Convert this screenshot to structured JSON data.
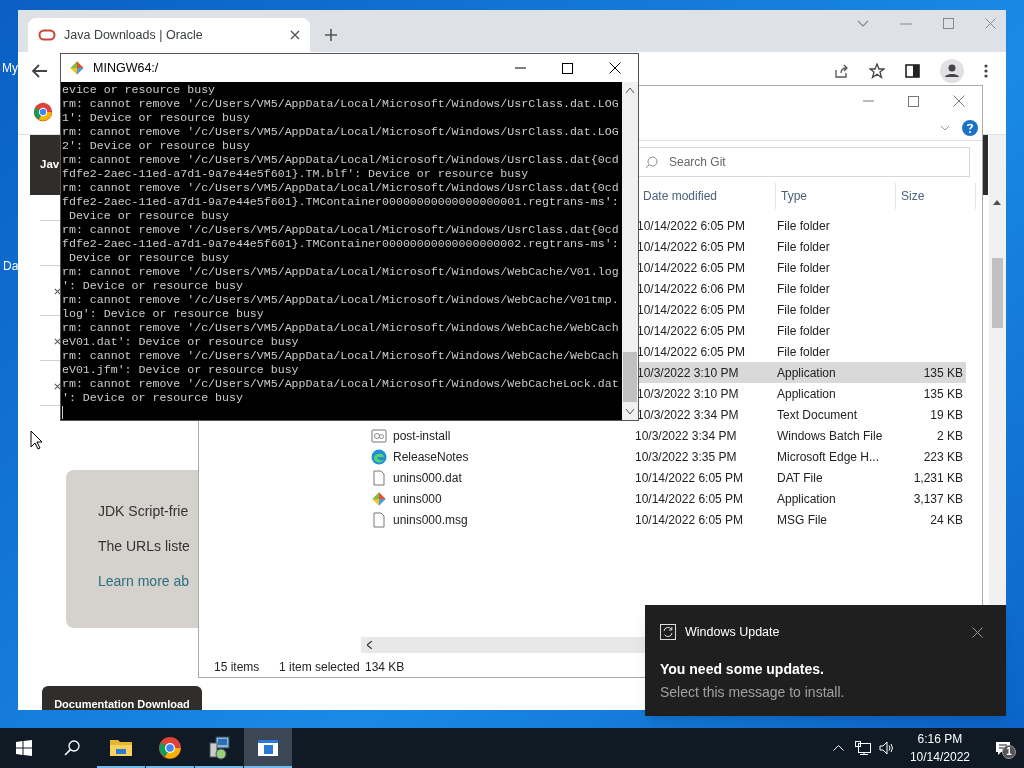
{
  "desktop": {
    "labels": [
      "My",
      "Da"
    ]
  },
  "browser": {
    "tab": {
      "title": "Java Downloads | Oracle",
      "selected": true
    },
    "page": {
      "banner": "Jav",
      "card_lines": [
        "JDK Script-frie",
        "The URLs liste"
      ],
      "card_link": "Learn more ab",
      "doc_button": "Documentation Download"
    }
  },
  "explorer": {
    "search": {
      "placeholder": "Search Git"
    },
    "columns": [
      "Date modified",
      "Type",
      "Size"
    ],
    "rows": [
      {
        "date": "10/14/2022 6:05 PM",
        "type": "File folder",
        "selected": false
      },
      {
        "date": "10/14/2022 6:05 PM",
        "type": "File folder",
        "selected": false
      },
      {
        "date": "10/14/2022 6:05 PM",
        "type": "File folder",
        "selected": false
      },
      {
        "date": "10/14/2022 6:06 PM",
        "type": "File folder",
        "selected": false
      },
      {
        "date": "10/14/2022 6:05 PM",
        "type": "File folder",
        "selected": false
      },
      {
        "date": "10/14/2022 6:05 PM",
        "type": "File folder",
        "selected": false
      },
      {
        "date": "10/14/2022 6:05 PM",
        "type": "File folder",
        "selected": false
      },
      {
        "date": "10/3/2022 3:10 PM",
        "type": "Application",
        "size": "135 KB",
        "selected": true
      },
      {
        "date": "10/3/2022 3:10 PM",
        "type": "Application",
        "size": "135 KB",
        "selected": false
      },
      {
        "date": "10/3/2022 3:34 PM",
        "type": "Text Document",
        "size": "19 KB",
        "selected": false
      },
      {
        "name": "post-install",
        "kind": "batch",
        "date": "10/3/2022 3:34 PM",
        "type": "Windows Batch File",
        "size": "2 KB",
        "selected": false
      },
      {
        "name": "ReleaseNotes",
        "kind": "edge",
        "date": "10/3/2022 3:35 PM",
        "type": "Microsoft Edge H...",
        "size": "223 KB",
        "selected": false
      },
      {
        "name": "unins000.dat",
        "kind": "file",
        "date": "10/14/2022 6:05 PM",
        "type": "DAT File",
        "size": "1,231 KB",
        "selected": false
      },
      {
        "name": "unins000",
        "kind": "app",
        "date": "10/14/2022 6:05 PM",
        "type": "Application",
        "size": "3,137 KB",
        "selected": false
      },
      {
        "name": "unins000.msg",
        "kind": "file",
        "date": "10/14/2022 6:05 PM",
        "type": "MSG File",
        "size": "24 KB",
        "selected": false
      }
    ],
    "status": {
      "items": "15 items",
      "selection": "1 item selected",
      "size": "134 KB"
    }
  },
  "terminal": {
    "title": "MINGW64:/",
    "lines": [
      "evice or resource busy",
      "rm: cannot remove '/c/Users/VM5/AppData/Local/Microsoft/Windows/UsrClass.dat.LOG",
      "1': Device or resource busy",
      "rm: cannot remove '/c/Users/VM5/AppData/Local/Microsoft/Windows/UsrClass.dat.LOG",
      "2': Device or resource busy",
      "rm: cannot remove '/c/Users/VM5/AppData/Local/Microsoft/Windows/UsrClass.dat{0cd",
      "fdfe2-2aec-11ed-a7d1-9a7e44e5f601}.TM.blf': Device or resource busy",
      "rm: cannot remove '/c/Users/VM5/AppData/Local/Microsoft/Windows/UsrClass.dat{0cd",
      "fdfe2-2aec-11ed-a7d1-9a7e44e5f601}.TMContainer00000000000000000001.regtrans-ms':",
      " Device or resource busy",
      "rm: cannot remove '/c/Users/VM5/AppData/Local/Microsoft/Windows/UsrClass.dat{0cd",
      "fdfe2-2aec-11ed-a7d1-9a7e44e5f601}.TMContainer00000000000000000002.regtrans-ms':",
      " Device or resource busy",
      "rm: cannot remove '/c/Users/VM5/AppData/Local/Microsoft/Windows/WebCache/V01.log",
      "': Device or resource busy",
      "rm: cannot remove '/c/Users/VM5/AppData/Local/Microsoft/Windows/WebCache/V01tmp.",
      "log': Device or resource busy",
      "rm: cannot remove '/c/Users/VM5/AppData/Local/Microsoft/Windows/WebCache/WebCach",
      "eV01.dat': Device or resource busy",
      "rm: cannot remove '/c/Users/VM5/AppData/Local/Microsoft/Windows/WebCache/WebCach",
      "eV01.jfm': Device or resource busy",
      "rm: cannot remove '/c/Users/VM5/AppData/Local/Microsoft/Windows/WebCacheLock.dat",
      "': Device or resource busy"
    ]
  },
  "notification": {
    "app": "Windows Update",
    "title": "You need some updates.",
    "body": "Select this message to install."
  },
  "taskbar": {
    "apps": [
      {
        "kind": "explorer",
        "open": true,
        "selected": false
      },
      {
        "kind": "chrome",
        "open": true,
        "selected": false
      },
      {
        "kind": "installer",
        "open": true,
        "selected": false
      },
      {
        "kind": "window",
        "open": true,
        "selected": true
      }
    ],
    "time": "6:16 PM",
    "date": "10/14/2022",
    "notification_count": "1"
  }
}
